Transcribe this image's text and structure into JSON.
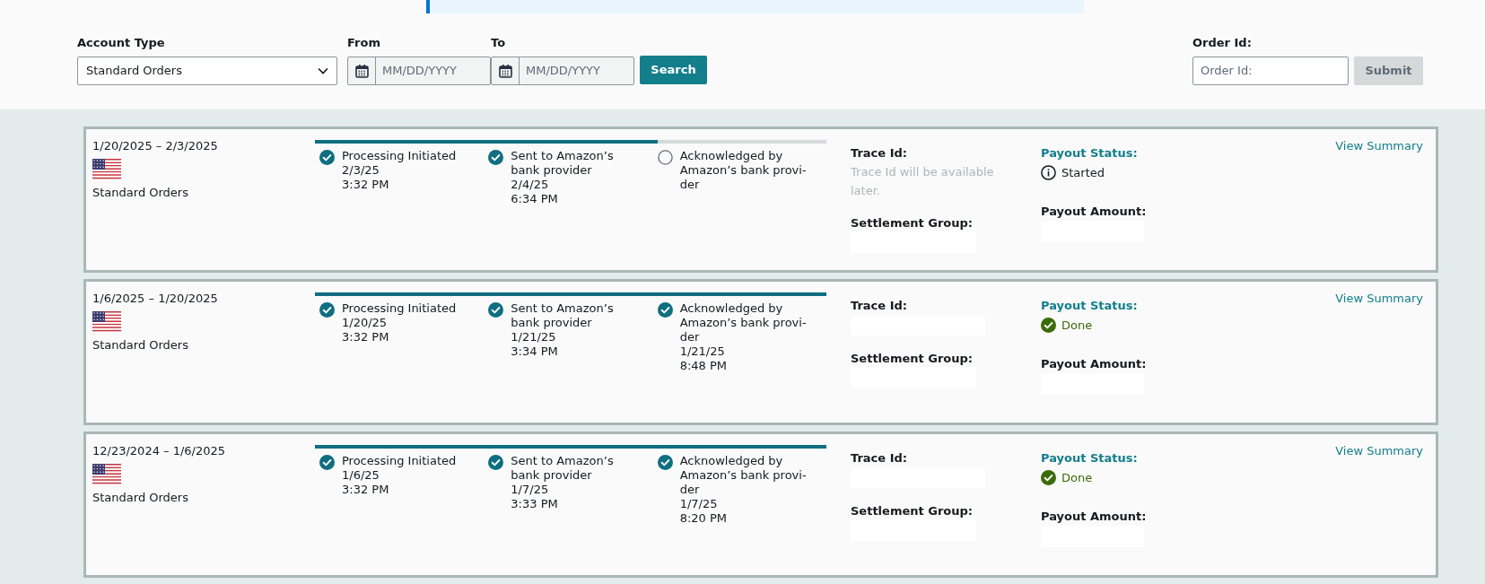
{
  "filters": {
    "account_type": {
      "label": "Account Type",
      "value": "Standard Orders"
    },
    "from": {
      "label": "From",
      "placeholder": "MM/DD/YYYY"
    },
    "to": {
      "label": "To",
      "placeholder": "MM/DD/YYYY"
    },
    "search_button": "Search",
    "order_id": {
      "label": "Order Id:",
      "placeholder": "Order Id:"
    },
    "submit_button": {
      "label": "Submit",
      "disabled": true
    }
  },
  "payouts": [
    {
      "period": "1/20/2025 – 2/3/2025",
      "account": "Standard Orders",
      "level": 0.67,
      "steps": [
        {
          "title": "Processing Initiated",
          "lines": [
            "2/3/25",
            "3:32 PM"
          ],
          "done": true
        },
        {
          "title": "Sent to Amazon’s bank provider",
          "lines": [
            "2/4/25",
            "6:34 PM"
          ],
          "done": true
        },
        {
          "title": "Acknowledged by Amazon’s bank provi-der",
          "done": false
        }
      ],
      "trace_label": "Trace Id:",
      "trace_note": "Trace Id will be available later.",
      "trace_redacted": false,
      "settlement_label": "Settlement Group:",
      "status_label": "Payout Status:",
      "status": {
        "kind": "info",
        "text": "Started"
      },
      "amount_label": "Payout Amount:",
      "link": "View Summary"
    },
    {
      "period": "1/6/2025 – 1/20/2025",
      "account": "Standard Orders",
      "level": 1,
      "steps": [
        {
          "title": "Processing Initiated",
          "lines": [
            "1/20/25",
            "3:32 PM"
          ],
          "done": true
        },
        {
          "title": "Sent to Amazon’s bank provider",
          "lines": [
            "1/21/25",
            "3:34 PM"
          ],
          "done": true
        },
        {
          "title": "Acknowledged by Amazon’s bank provi-der",
          "lines": [
            "1/21/25",
            "8:48 PM"
          ],
          "done": true
        }
      ],
      "trace_label": "Trace Id:",
      "trace_redacted": true,
      "settlement_label": "Settlement Group:",
      "status_label": "Payout Status:",
      "status": {
        "kind": "done",
        "text": "Done"
      },
      "amount_label": "Payout Amount:",
      "link": "View Summary"
    },
    {
      "period": "12/23/2024 – 1/6/2025",
      "account": "Standard Orders",
      "level": 1,
      "steps": [
        {
          "title": "Processing Initiated",
          "lines": [
            "1/6/25",
            "3:32 PM"
          ],
          "done": true
        },
        {
          "title": "Sent to Amazon’s bank provider",
          "lines": [
            "1/7/25",
            "3:33 PM"
          ],
          "done": true
        },
        {
          "title": "Acknowledged by Amazon’s bank provi-der",
          "lines": [
            "1/7/25",
            "8:20 PM"
          ],
          "done": true
        }
      ],
      "trace_label": "Trace Id:",
      "trace_redacted": true,
      "settlement_label": "Settlement Group:",
      "status_label": "Payout Status:",
      "status": {
        "kind": "done",
        "text": "Done"
      },
      "amount_label": "Payout Amount:",
      "link": "View Summary"
    }
  ]
}
